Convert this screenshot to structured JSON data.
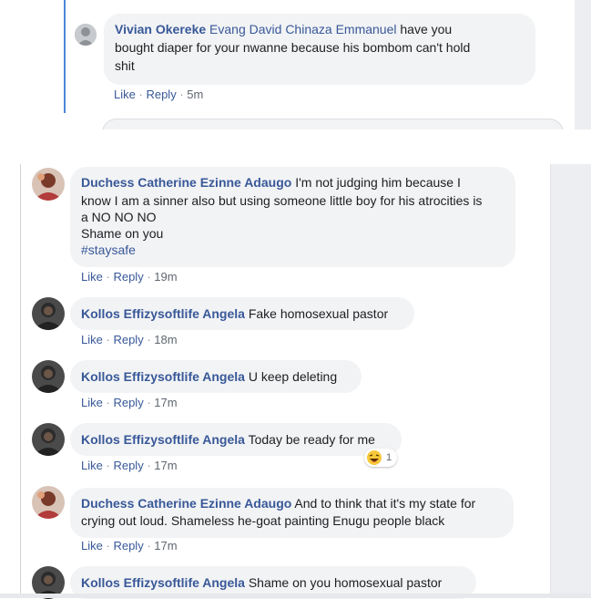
{
  "top": {
    "comment": {
      "author": "Vivian Okereke",
      "tagged": "Evang David Chinaza Emmanuel",
      "text_line1": " have you",
      "text_line2": "bought diaper for your nwanne because his bombom can't hold",
      "text_line3": "shit",
      "like": "Like",
      "reply": "Reply",
      "time": "5m"
    }
  },
  "comments": [
    {
      "author": "Duchess Catherine Ezinne Adaugo",
      "lines": [
        " I'm not judging him because I",
        "know I am a sinner also but using someone little boy for his atrocities is",
        "a NO NO NO",
        "Shame on you"
      ],
      "hashtag": "#staysafe",
      "like": "Like",
      "reply": "Reply",
      "time": "19m"
    },
    {
      "author": "Kollos Effizysoftlife Angela",
      "text": " Fake homosexual pastor",
      "like": "Like",
      "reply": "Reply",
      "time": "18m"
    },
    {
      "author": "Kollos Effizysoftlife Angela",
      "text": " U keep deleting",
      "like": "Like",
      "reply": "Reply",
      "time": "17m"
    },
    {
      "author": "Kollos Effizysoftlife Angela",
      "text": " Today be ready for me",
      "like": "Like",
      "reply": "Reply",
      "time": "17m",
      "reaction_icon": "laughing-emoji-icon",
      "reaction_count": "1"
    },
    {
      "author": "Duchess Catherine Ezinne Adaugo",
      "lines": [
        " And to think that it's my state for",
        "crying out loud. Shameless he-goat painting Enugu people black"
      ],
      "like": "Like",
      "reply": "Reply",
      "time": "17m"
    },
    {
      "author": "Kollos Effizysoftlife Angela",
      "text": " Shame on you homosexual pastor"
    }
  ],
  "ui": {
    "separator": "·"
  },
  "colors": {
    "name": "#385898",
    "bubble": "#f2f3f5",
    "meta": "#606770"
  }
}
